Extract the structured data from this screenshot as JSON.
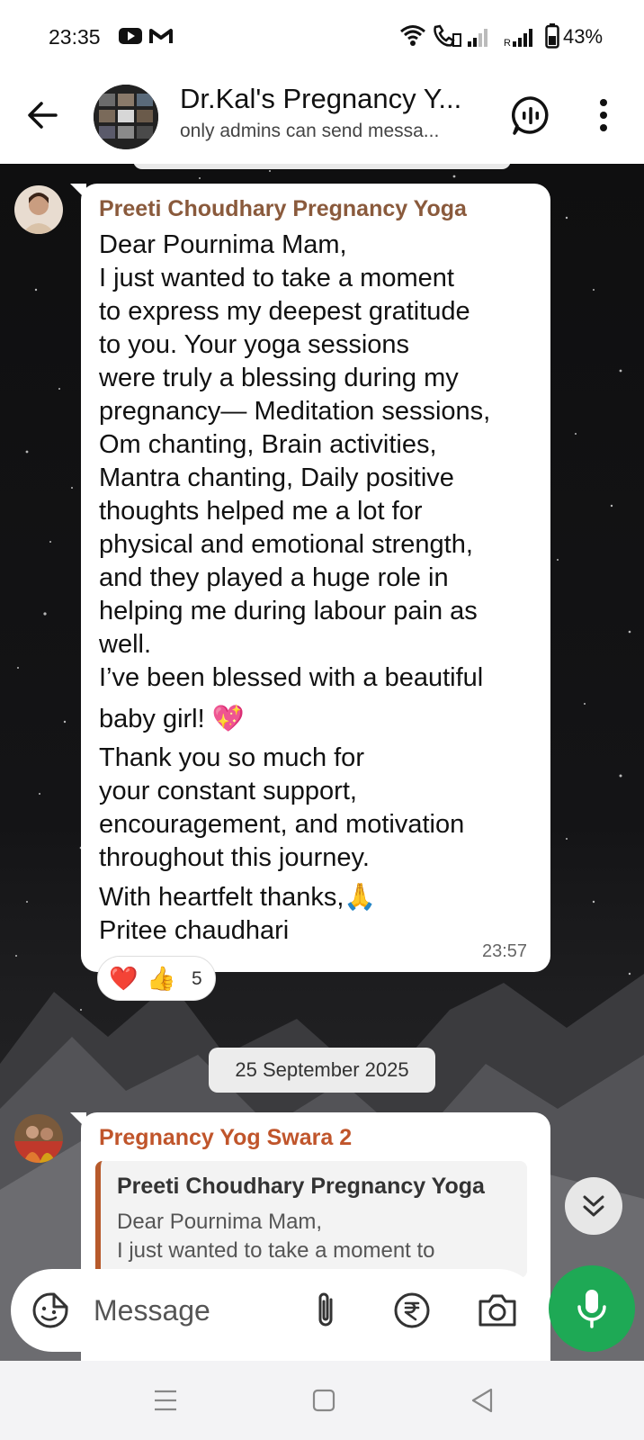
{
  "status_bar": {
    "time": "23:35",
    "battery": "43%",
    "icons": [
      "youtube-icon",
      "gmail-icon",
      "wifi-icon",
      "wifi-call-icon",
      "signal-icon",
      "signal-roaming-icon",
      "battery-icon"
    ]
  },
  "header": {
    "title": "Dr.Kal's Pregnancy Y...",
    "subtitle": "only admins can send messa...",
    "back_icon": "arrow-left-icon",
    "voice_chat_icon": "voice-chat-icon",
    "more_icon": "more-vertical-icon"
  },
  "messages": [
    {
      "sender": "Preeti Choudhary Pregnancy Yoga",
      "sender_color": "#8a5a3c",
      "lines": [
        "Dear Pournima Mam,",
        "I just wanted to take a moment",
        "to express my deepest gratitude",
        "to you. Your yoga sessions",
        "were truly a blessing during my",
        "pregnancy— Meditation sessions,",
        "Om chanting, Brain activities,",
        "Mantra chanting, Daily positive",
        "thoughts helped me a lot for",
        "physical and emotional strength,",
        "and they played a huge role in",
        "helping me during labour pain as",
        "well.",
        "I’ve been blessed with a beautiful",
        "baby girl! 💖",
        "Thank you so much for",
        "your constant support,",
        "encouragement, and motivation",
        "throughout this journey.",
        "With heartfelt thanks,🙏",
        "Pritee chaudhari"
      ],
      "time": "23:57",
      "reactions": {
        "emojis": [
          "❤️",
          "👍"
        ],
        "count": "5"
      }
    },
    {
      "sender": "Pregnancy Yog Swara 2",
      "sender_color": "#c0552b",
      "quote": {
        "sender": "Preeti Choudhary Pregnancy Yoga",
        "lines": [
          "Dear Pournima Mam,",
          "I just wanted to take a moment to"
        ]
      }
    }
  ],
  "date_separator": "25 September 2025",
  "composer": {
    "placeholder": "Message",
    "icons": [
      "emoji-sticker-icon",
      "paperclip-icon",
      "rupee-icon",
      "camera-icon",
      "microphone-icon"
    ]
  },
  "colors": {
    "accent_green": "#1ea955"
  }
}
